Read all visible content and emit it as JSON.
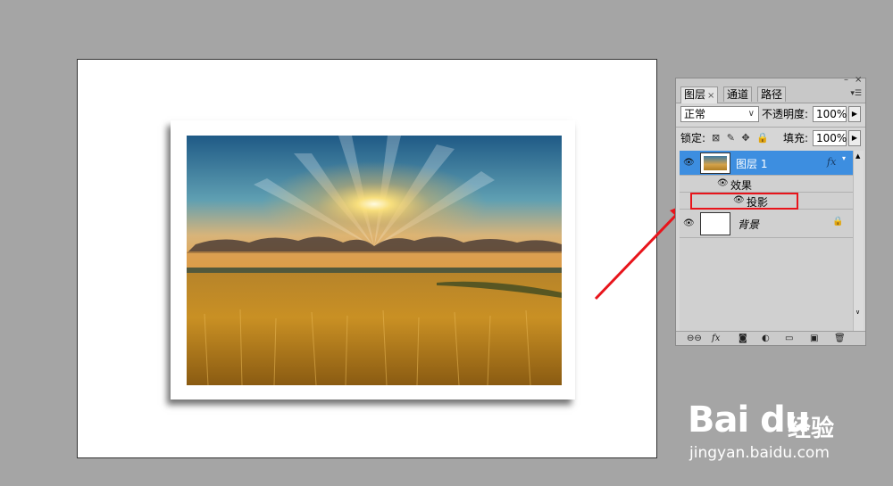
{
  "panel": {
    "tabs": [
      {
        "label": "图层",
        "close": "×"
      },
      {
        "label": "通道"
      },
      {
        "label": "路径"
      }
    ],
    "window_controls": {
      "minimize": "–",
      "close": "×"
    },
    "blend_mode": "正常",
    "opacity_label": "不透明度:",
    "opacity_value": "100%",
    "lock_label": "锁定:",
    "fill_label": "填充:",
    "fill_value": "100%",
    "layers": [
      {
        "name": "图层 1",
        "fx": "fx",
        "selected": true
      },
      {
        "name": "效果"
      },
      {
        "name": "投影"
      },
      {
        "name": "背景"
      }
    ],
    "bottom_icons": [
      "link-icon",
      "fx-icon",
      "mask-icon",
      "adjustment-icon",
      "group-icon",
      "new-layer-icon",
      "trash-icon"
    ],
    "bottom_fx_label": "fx"
  },
  "colors": {
    "background": "#a5a5a5",
    "selected_layer": "#3d8ee0",
    "highlight_box": "#e8141b",
    "arrow": "#e8141b"
  },
  "watermark": {
    "brand": "Bai du",
    "cn": "经验",
    "url": "jingyan.baidu.com"
  }
}
